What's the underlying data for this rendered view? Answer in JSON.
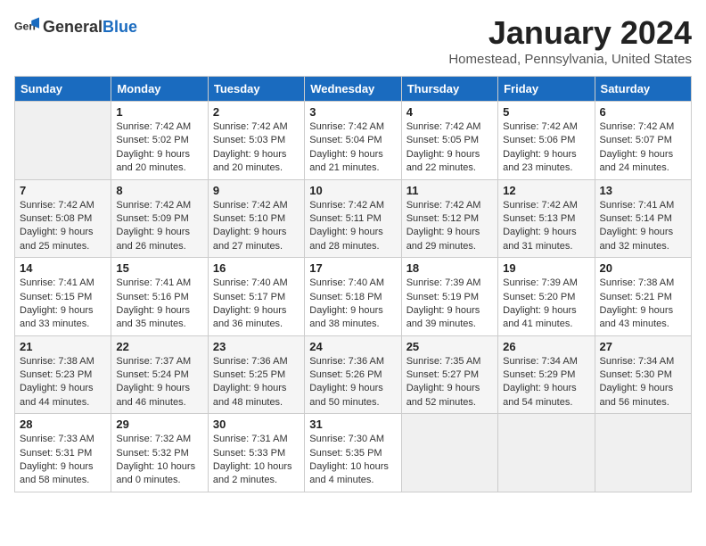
{
  "header": {
    "logo_general": "General",
    "logo_blue": "Blue",
    "month_title": "January 2024",
    "location": "Homestead, Pennsylvania, United States"
  },
  "weekdays": [
    "Sunday",
    "Monday",
    "Tuesday",
    "Wednesday",
    "Thursday",
    "Friday",
    "Saturday"
  ],
  "weeks": [
    [
      {
        "day": "",
        "empty": true
      },
      {
        "day": "1",
        "sunrise": "Sunrise: 7:42 AM",
        "sunset": "Sunset: 5:02 PM",
        "daylight": "Daylight: 9 hours and 20 minutes."
      },
      {
        "day": "2",
        "sunrise": "Sunrise: 7:42 AM",
        "sunset": "Sunset: 5:03 PM",
        "daylight": "Daylight: 9 hours and 20 minutes."
      },
      {
        "day": "3",
        "sunrise": "Sunrise: 7:42 AM",
        "sunset": "Sunset: 5:04 PM",
        "daylight": "Daylight: 9 hours and 21 minutes."
      },
      {
        "day": "4",
        "sunrise": "Sunrise: 7:42 AM",
        "sunset": "Sunset: 5:05 PM",
        "daylight": "Daylight: 9 hours and 22 minutes."
      },
      {
        "day": "5",
        "sunrise": "Sunrise: 7:42 AM",
        "sunset": "Sunset: 5:06 PM",
        "daylight": "Daylight: 9 hours and 23 minutes."
      },
      {
        "day": "6",
        "sunrise": "Sunrise: 7:42 AM",
        "sunset": "Sunset: 5:07 PM",
        "daylight": "Daylight: 9 hours and 24 minutes."
      }
    ],
    [
      {
        "day": "7",
        "sunrise": "Sunrise: 7:42 AM",
        "sunset": "Sunset: 5:08 PM",
        "daylight": "Daylight: 9 hours and 25 minutes."
      },
      {
        "day": "8",
        "sunrise": "Sunrise: 7:42 AM",
        "sunset": "Sunset: 5:09 PM",
        "daylight": "Daylight: 9 hours and 26 minutes."
      },
      {
        "day": "9",
        "sunrise": "Sunrise: 7:42 AM",
        "sunset": "Sunset: 5:10 PM",
        "daylight": "Daylight: 9 hours and 27 minutes."
      },
      {
        "day": "10",
        "sunrise": "Sunrise: 7:42 AM",
        "sunset": "Sunset: 5:11 PM",
        "daylight": "Daylight: 9 hours and 28 minutes."
      },
      {
        "day": "11",
        "sunrise": "Sunrise: 7:42 AM",
        "sunset": "Sunset: 5:12 PM",
        "daylight": "Daylight: 9 hours and 29 minutes."
      },
      {
        "day": "12",
        "sunrise": "Sunrise: 7:42 AM",
        "sunset": "Sunset: 5:13 PM",
        "daylight": "Daylight: 9 hours and 31 minutes."
      },
      {
        "day": "13",
        "sunrise": "Sunrise: 7:41 AM",
        "sunset": "Sunset: 5:14 PM",
        "daylight": "Daylight: 9 hours and 32 minutes."
      }
    ],
    [
      {
        "day": "14",
        "sunrise": "Sunrise: 7:41 AM",
        "sunset": "Sunset: 5:15 PM",
        "daylight": "Daylight: 9 hours and 33 minutes."
      },
      {
        "day": "15",
        "sunrise": "Sunrise: 7:41 AM",
        "sunset": "Sunset: 5:16 PM",
        "daylight": "Daylight: 9 hours and 35 minutes."
      },
      {
        "day": "16",
        "sunrise": "Sunrise: 7:40 AM",
        "sunset": "Sunset: 5:17 PM",
        "daylight": "Daylight: 9 hours and 36 minutes."
      },
      {
        "day": "17",
        "sunrise": "Sunrise: 7:40 AM",
        "sunset": "Sunset: 5:18 PM",
        "daylight": "Daylight: 9 hours and 38 minutes."
      },
      {
        "day": "18",
        "sunrise": "Sunrise: 7:39 AM",
        "sunset": "Sunset: 5:19 PM",
        "daylight": "Daylight: 9 hours and 39 minutes."
      },
      {
        "day": "19",
        "sunrise": "Sunrise: 7:39 AM",
        "sunset": "Sunset: 5:20 PM",
        "daylight": "Daylight: 9 hours and 41 minutes."
      },
      {
        "day": "20",
        "sunrise": "Sunrise: 7:38 AM",
        "sunset": "Sunset: 5:21 PM",
        "daylight": "Daylight: 9 hours and 43 minutes."
      }
    ],
    [
      {
        "day": "21",
        "sunrise": "Sunrise: 7:38 AM",
        "sunset": "Sunset: 5:23 PM",
        "daylight": "Daylight: 9 hours and 44 minutes."
      },
      {
        "day": "22",
        "sunrise": "Sunrise: 7:37 AM",
        "sunset": "Sunset: 5:24 PM",
        "daylight": "Daylight: 9 hours and 46 minutes."
      },
      {
        "day": "23",
        "sunrise": "Sunrise: 7:36 AM",
        "sunset": "Sunset: 5:25 PM",
        "daylight": "Daylight: 9 hours and 48 minutes."
      },
      {
        "day": "24",
        "sunrise": "Sunrise: 7:36 AM",
        "sunset": "Sunset: 5:26 PM",
        "daylight": "Daylight: 9 hours and 50 minutes."
      },
      {
        "day": "25",
        "sunrise": "Sunrise: 7:35 AM",
        "sunset": "Sunset: 5:27 PM",
        "daylight": "Daylight: 9 hours and 52 minutes."
      },
      {
        "day": "26",
        "sunrise": "Sunrise: 7:34 AM",
        "sunset": "Sunset: 5:29 PM",
        "daylight": "Daylight: 9 hours and 54 minutes."
      },
      {
        "day": "27",
        "sunrise": "Sunrise: 7:34 AM",
        "sunset": "Sunset: 5:30 PM",
        "daylight": "Daylight: 9 hours and 56 minutes."
      }
    ],
    [
      {
        "day": "28",
        "sunrise": "Sunrise: 7:33 AM",
        "sunset": "Sunset: 5:31 PM",
        "daylight": "Daylight: 9 hours and 58 minutes."
      },
      {
        "day": "29",
        "sunrise": "Sunrise: 7:32 AM",
        "sunset": "Sunset: 5:32 PM",
        "daylight": "Daylight: 10 hours and 0 minutes."
      },
      {
        "day": "30",
        "sunrise": "Sunrise: 7:31 AM",
        "sunset": "Sunset: 5:33 PM",
        "daylight": "Daylight: 10 hours and 2 minutes."
      },
      {
        "day": "31",
        "sunrise": "Sunrise: 7:30 AM",
        "sunset": "Sunset: 5:35 PM",
        "daylight": "Daylight: 10 hours and 4 minutes."
      },
      {
        "day": "",
        "empty": true
      },
      {
        "day": "",
        "empty": true
      },
      {
        "day": "",
        "empty": true
      }
    ]
  ]
}
